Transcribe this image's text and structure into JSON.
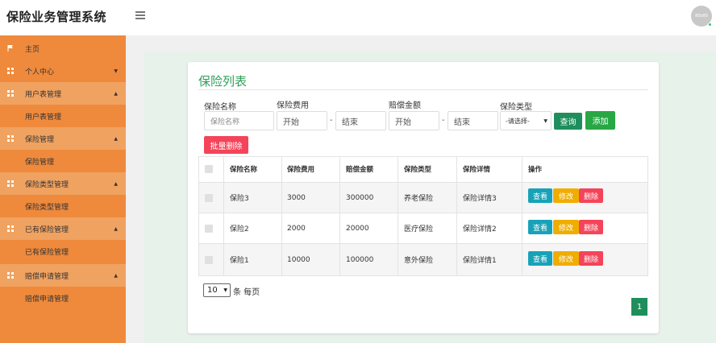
{
  "header": {
    "app_title": "保险业务管理系统",
    "avatar_text": "80x80"
  },
  "sidebar": {
    "items": [
      {
        "label": "主页",
        "icon": "flag-icon",
        "type": "parent",
        "expanded": false
      },
      {
        "label": "个人中心",
        "icon": "grid-icon",
        "type": "parent",
        "arrow": "▼"
      },
      {
        "label": "用户表管理",
        "icon": "grid-icon",
        "type": "parent",
        "arrow": "▲"
      },
      {
        "label": "用户表管理",
        "type": "sub"
      },
      {
        "label": "保险管理",
        "icon": "grid-icon",
        "type": "parent",
        "arrow": "▲"
      },
      {
        "label": "保险管理",
        "type": "sub"
      },
      {
        "label": "保险类型管理",
        "icon": "grid-icon",
        "type": "parent",
        "arrow": "▲"
      },
      {
        "label": "保险类型管理",
        "type": "sub"
      },
      {
        "label": "已有保险管理",
        "icon": "grid-icon",
        "type": "parent",
        "arrow": "▲"
      },
      {
        "label": "已有保险管理",
        "type": "sub"
      },
      {
        "label": "赔偿申请管理",
        "icon": "grid-icon",
        "type": "parent",
        "arrow": "▲"
      },
      {
        "label": "赔偿申请管理",
        "type": "sub"
      }
    ]
  },
  "page": {
    "title": "保险列表"
  },
  "filters": {
    "name_label": "保险名称",
    "name_placeholder": "保险名称",
    "fee_label": "保险费用",
    "fee_start": "开始",
    "fee_end": "结束",
    "payout_label": "赔偿金额",
    "payout_start": "开始",
    "payout_end": "结束",
    "type_label": "保险类型",
    "type_selected": "-请选择-",
    "dash": "-",
    "query_button": "查询",
    "add_button": "添加",
    "batch_delete_button": "批量删除"
  },
  "table": {
    "headers": [
      "保险名称",
      "保险费用",
      "赔偿金额",
      "保险类型",
      "保险详情",
      "操作"
    ],
    "rows": [
      {
        "name": "保险3",
        "fee": "3000",
        "payout": "300000",
        "type": "养老保险",
        "detail": "保险详情3"
      },
      {
        "name": "保险2",
        "fee": "2000",
        "payout": "20000",
        "type": "医疗保险",
        "detail": "保险详情2"
      },
      {
        "name": "保险1",
        "fee": "10000",
        "payout": "100000",
        "type": "意外保险",
        "detail": "保险详情1"
      }
    ],
    "actions": {
      "view": "查看",
      "edit": "修改",
      "delete": "删除"
    }
  },
  "pagination": {
    "page_size": "10",
    "page_size_label": "条 每页",
    "current_page": "1"
  },
  "colors": {
    "sidebar": "#ef8a3c",
    "sidebar_sub": "#f0a260",
    "title_green": "#2f9e5a",
    "query": "#1e8e5c",
    "add": "#28a745",
    "danger": "#f4445a",
    "view": "#17a2b8",
    "edit": "#f0ad00"
  }
}
